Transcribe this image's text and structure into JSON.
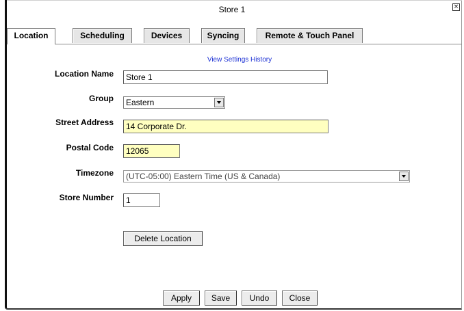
{
  "window": {
    "title": "Store 1",
    "close_glyph": "×"
  },
  "tabs": [
    {
      "label": "Location",
      "active": true
    },
    {
      "label": "Scheduling",
      "active": false
    },
    {
      "label": "Devices",
      "active": false
    },
    {
      "label": "Syncing",
      "active": false
    },
    {
      "label": "Remote & Touch Panel",
      "active": false
    }
  ],
  "history_link": "View Settings History",
  "form": {
    "location_name": {
      "label": "Location Name",
      "value": "Store 1"
    },
    "group": {
      "label": "Group",
      "value": "Eastern"
    },
    "street_address": {
      "label": "Street Address",
      "value": "14 Corporate Dr."
    },
    "postal_code": {
      "label": "Postal Code",
      "value": "12065"
    },
    "timezone": {
      "label": "Timezone",
      "value": "(UTC-05:00) Eastern Time (US & Canada)"
    },
    "store_number": {
      "label": "Store Number",
      "value": "1"
    }
  },
  "delete_button": "Delete Location",
  "footer": {
    "apply": "Apply",
    "save": "Save",
    "undo": "Undo",
    "close": "Close"
  },
  "colors": {
    "highlight_field": "#ffffc0",
    "link": "#1a2fd4"
  }
}
